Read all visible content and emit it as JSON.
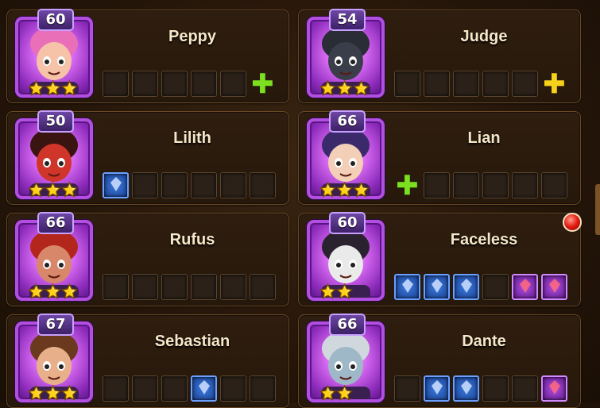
{
  "heroes": [
    {
      "name": "Peppy",
      "level": "60",
      "stars": 3,
      "skin": "#f6c2a8",
      "hair": "#e86fb8",
      "slots": [
        "empty",
        "empty",
        "empty",
        "empty",
        "empty",
        "plus-green"
      ]
    },
    {
      "name": "Judge",
      "level": "54",
      "stars": 3,
      "skin": "#3a3d4a",
      "hair": "#2a2c36",
      "slots": [
        "empty",
        "empty",
        "empty",
        "empty",
        "empty",
        "plus-gold"
      ]
    },
    {
      "name": "Lilith",
      "level": "50",
      "stars": 3,
      "skin": "#d0352a",
      "hair": "#3a1410",
      "slots": [
        "item-blue",
        "empty",
        "empty",
        "empty",
        "empty",
        "empty"
      ]
    },
    {
      "name": "Lian",
      "level": "66",
      "stars": 3,
      "skin": "#f4cfb8",
      "hair": "#3b2a6b",
      "slots": [
        "plus-green",
        "empty",
        "empty",
        "empty",
        "empty",
        "empty"
      ]
    },
    {
      "name": "Rufus",
      "level": "66",
      "stars": 3,
      "skin": "#d9876a",
      "hair": "#b3261c",
      "slots": [
        "empty",
        "empty",
        "empty",
        "empty",
        "empty",
        "empty"
      ]
    },
    {
      "name": "Faceless",
      "level": "60",
      "stars": 2,
      "skin": "#eaeaea",
      "hair": "#2b2230",
      "slots": [
        "item-blue",
        "item-blue",
        "item-blue",
        "empty",
        "item-purple",
        "item-purple"
      ]
    },
    {
      "name": "Sebastian",
      "level": "67",
      "stars": 3,
      "skin": "#e8b08a",
      "hair": "#6b3a1e",
      "slots": [
        "empty",
        "empty",
        "empty",
        "item-blue",
        "empty",
        "empty"
      ]
    },
    {
      "name": "Dante",
      "level": "66",
      "stars": 2,
      "skin": "#9fb8c8",
      "hair": "#d0d8de",
      "slots": [
        "empty",
        "item-blue",
        "item-blue",
        "empty",
        "empty",
        "item-purple"
      ]
    }
  ],
  "notification": {
    "color": "#e21a10"
  }
}
